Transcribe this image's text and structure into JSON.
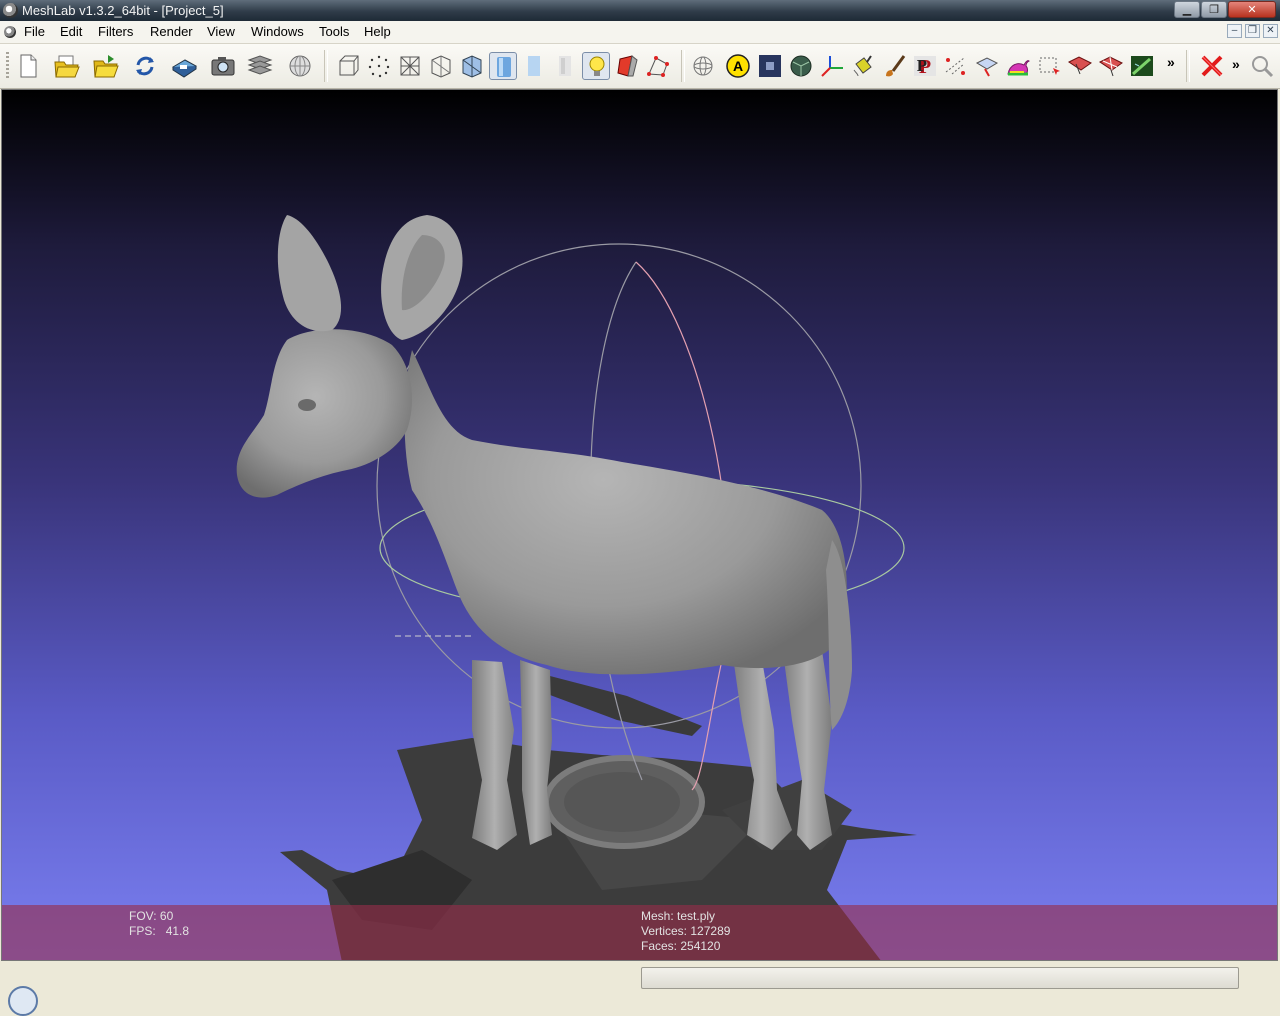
{
  "window": {
    "title": "MeshLab v1.3.2_64bit - [Project_5]",
    "minimize_glyph": "▁",
    "restore_glyph": "❐",
    "close_glyph": "✕"
  },
  "menu": {
    "items": [
      "File",
      "Edit",
      "Filters",
      "Render",
      "View",
      "Windows",
      "Tools",
      "Help"
    ],
    "mdi_buttons": [
      "–",
      "❐",
      "✕"
    ]
  },
  "toolbar": {
    "overflow_glyph": "»",
    "icons": [
      "new-project-icon",
      "open-project-icon",
      "import-mesh-icon",
      "reload-icon",
      "export-mesh-icon",
      "snapshot-icon",
      "layers-icon",
      "meshlab-server-icon",
      "bounding-box-icon",
      "points-icon",
      "wireframe-icon",
      "hidden-lines-icon",
      "flat-lines-icon",
      "flat-icon",
      "smooth-icon",
      "texture-icon",
      "light-icon",
      "backface-icon",
      "normals-icon",
      "trackball-icon",
      "annotation-icon",
      "color-picker-icon",
      "sphere-icon",
      "axis-icon",
      "paint-bucket-icon",
      "paint-brush-icon",
      "pickpoints-icon",
      "measure-icon",
      "align-icon",
      "rabbit-icon",
      "select-faces-icon",
      "select-vertices-icon",
      "select-connected-icon",
      "texture-param-icon",
      "delete-icon",
      "search-icon"
    ],
    "active_tools": [
      "smooth-icon",
      "light-icon"
    ]
  },
  "viewport": {
    "model_color": "#9a9a9a",
    "info": {
      "fov_label": "FOV:",
      "fov_value": "60",
      "fps_label": "FPS:",
      "fps_value": "41.8",
      "mesh_label": "Mesh:",
      "mesh_value": "test.ply",
      "vertices_label": "Vertices:",
      "vertices_value": "127289",
      "faces_label": "Faces:",
      "faces_value": "254120"
    }
  },
  "status": {
    "progress": 0
  }
}
